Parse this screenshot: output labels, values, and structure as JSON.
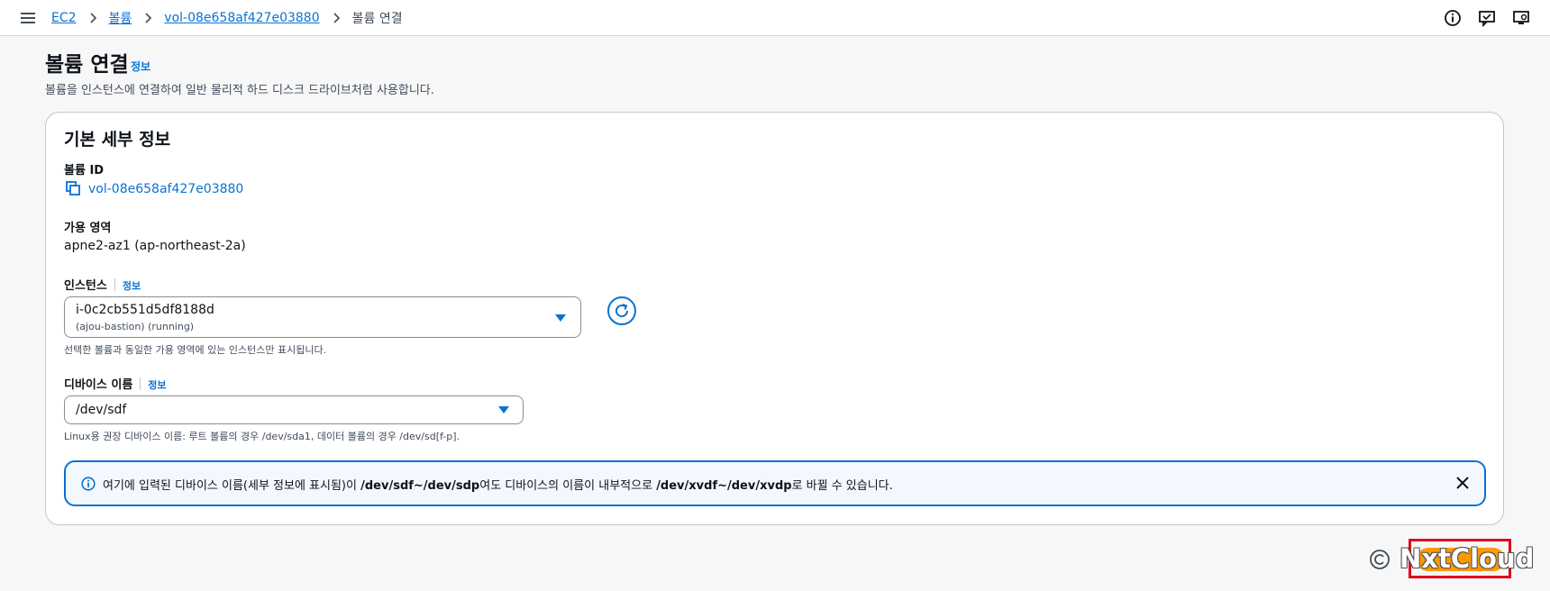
{
  "breadcrumbs": {
    "items": [
      "EC2",
      "볼륨",
      "vol-08e658af427e03880"
    ],
    "current": "볼륨 연결"
  },
  "page": {
    "title": "볼륨 연결",
    "info_label": "정보",
    "description": "볼륨을 인스턴스에 연결하여 일반 물리적 하드 디스크 드라이브처럼 사용합니다."
  },
  "details": {
    "section_title": "기본 세부 정보",
    "volume_id_label": "볼륨 ID",
    "volume_id": "vol-08e658af427e03880",
    "az_label": "가용 영역",
    "az_value": "apne2-az1 (ap-northeast-2a)",
    "instance_label": "인스턴스",
    "instance_info": "정보",
    "instance_id": "i-0c2cb551d5df8188d",
    "instance_sub": "(ajou-bastion) (running)",
    "instance_hint": "선택한 볼륨과 동일한 가용 영역에 있는 인스턴스만 표시됩니다.",
    "device_label": "디바이스 이름",
    "device_info": "정보",
    "device_value": "/dev/sdf",
    "device_hint": "Linux용 권장 디바이스 이름: 루트 볼륨의 경우 /dev/sda1, 데이터 볼륨의 경우 /dev/sd[f-p]."
  },
  "alert": {
    "part1": "여기에 입력된 디바이스 이름(세부 정보에 표시됨)이 ",
    "bold1": "/dev/sdf~/dev/sdp",
    "part2": "여도 디바이스의 이름이 내부적으로 ",
    "bold2": "/dev/xvdf~/dev/xvdp",
    "part3": "로 바뀔 수 있습니다."
  },
  "watermark": "NxtCloud",
  "icons": {
    "menu": "hamburger-menu-icon",
    "info": "info-icon",
    "feedback": "feedback-icon",
    "display": "display-settings-icon",
    "copy": "copy-icon",
    "refresh": "refresh-icon",
    "close": "close-icon"
  },
  "colors": {
    "link": "#0972d3",
    "primary_button": "#ff9900",
    "alert_bg": "#f2f8fd",
    "highlight": "#e0001b"
  }
}
